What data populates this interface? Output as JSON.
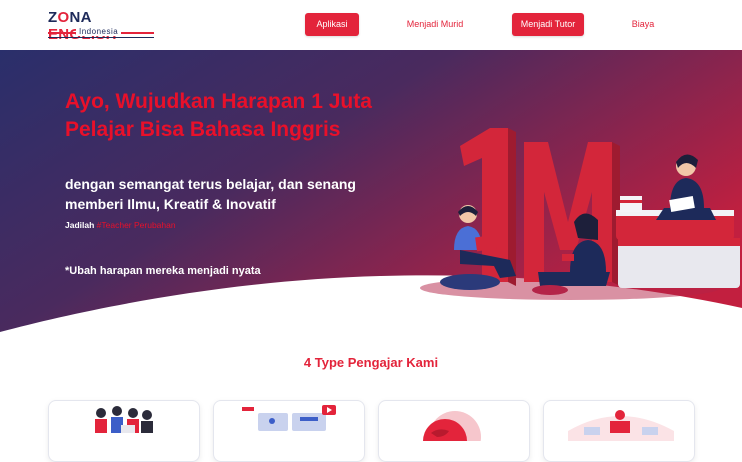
{
  "brand": {
    "logo_part1": "Z",
    "logo_part2": "NA",
    "logo_part3": "ENGLISH",
    "logo_sub": "Indonesia",
    "colors": {
      "red": "#e3243b",
      "navy": "#1d2a5a"
    }
  },
  "nav": {
    "aplikasi": "Aplikasi",
    "menjadi_murid": "Menjadi Murid",
    "menjadi_tutor": "Menjadi Tutor",
    "biaya": "Biaya"
  },
  "hero": {
    "title": "Ayo, Wujudkan Harapan 1 Juta Pelajar Bisa Bahasa Inggris",
    "subtitle": "dengan semangat terus belajar, dan senang memberi Ilmu, Kreatif & Inovatif",
    "tag_prefix": "Jadilah",
    "tag_hash": "#Teacher Perubahan",
    "note": "*Ubah harapan mereka menjadi nyata",
    "illustration_text": "1M"
  },
  "section": {
    "title": "4 Type Pengajar Kami"
  },
  "cards": [
    {
      "icon": "group-people-icon"
    },
    {
      "icon": "video-lesson-icon"
    },
    {
      "icon": "globe-icon"
    },
    {
      "icon": "teacher-desk-icon"
    }
  ]
}
